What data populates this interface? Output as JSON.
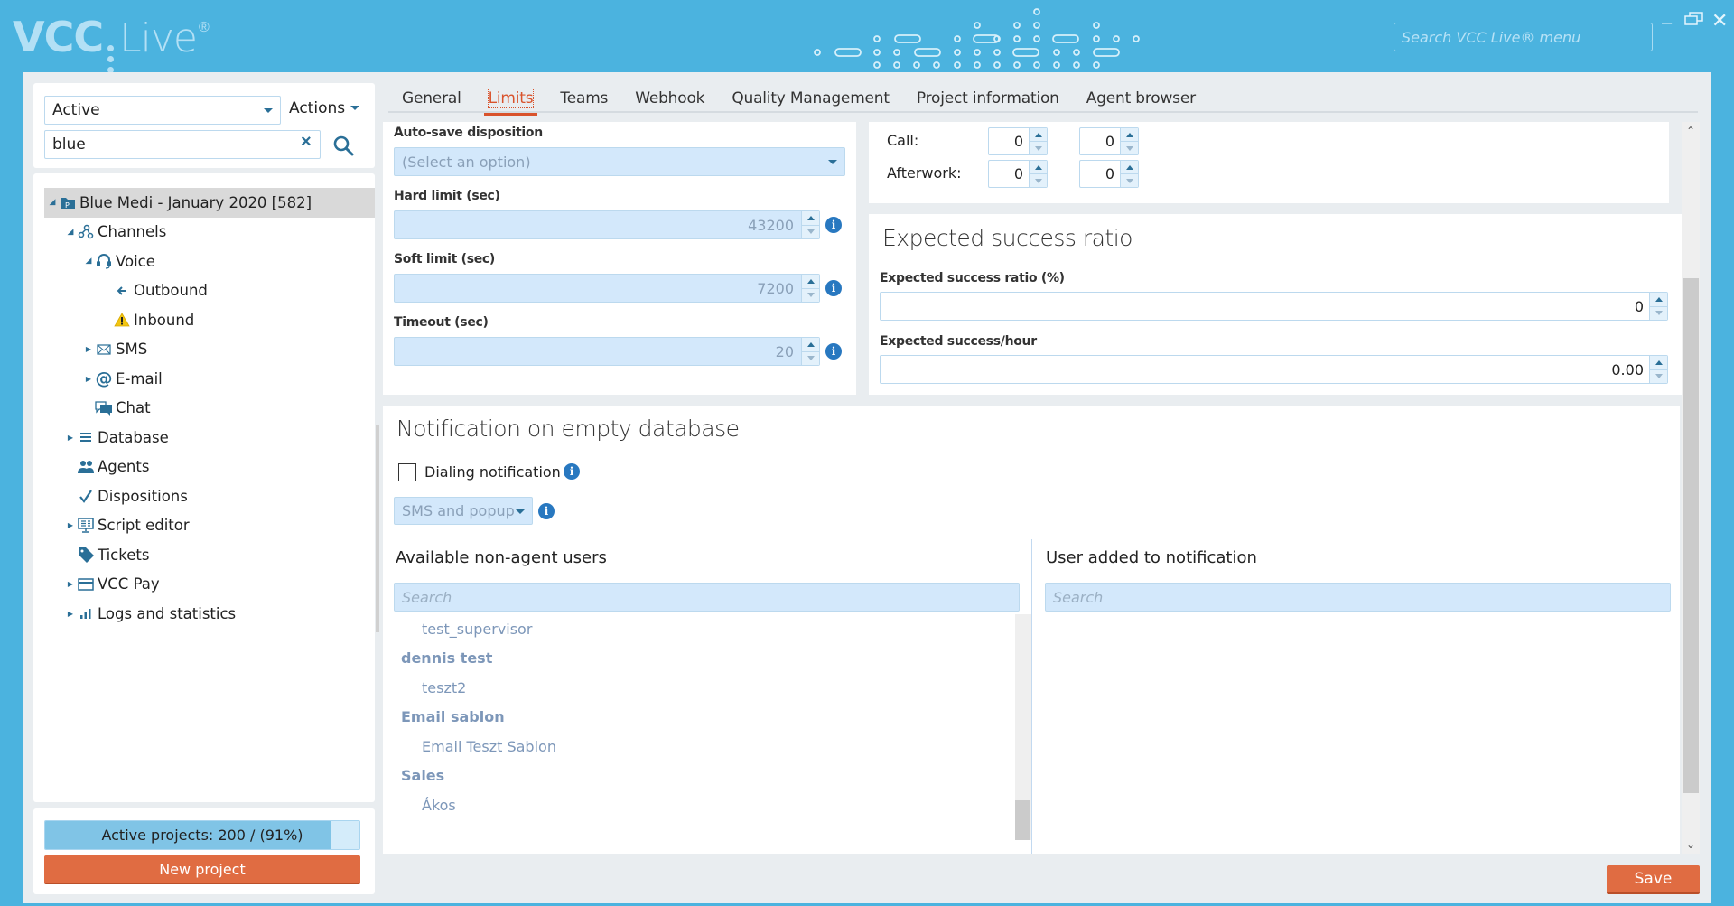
{
  "app": {
    "logo_main": "VCC",
    "logo_sub": "Live",
    "logo_mark": "®",
    "menu_search_placeholder": "Search VCC Live® menu",
    "window_controls": [
      "minimize-icon",
      "restore-icon",
      "close-icon"
    ]
  },
  "sidebar": {
    "status_filter": "Active",
    "actions_label": "Actions",
    "search_value": "blue",
    "tree": [
      {
        "label": "Blue Medi - January 2020 [582]",
        "level": 0,
        "toggle": "expanded",
        "icon": "project-icon",
        "selected": true
      },
      {
        "label": "Channels",
        "level": 1,
        "toggle": "expanded",
        "icon": "channels-icon"
      },
      {
        "label": "Voice",
        "level": 2,
        "toggle": "expanded",
        "icon": "headset-icon"
      },
      {
        "label": "Outbound",
        "level": 3,
        "toggle": "none",
        "icon": "arrow-left-icon"
      },
      {
        "label": "Inbound",
        "level": 3,
        "toggle": "none",
        "icon": "warning-icon"
      },
      {
        "label": "SMS",
        "level": 2,
        "toggle": "collapsed",
        "icon": "envelope-icon"
      },
      {
        "label": "E-mail",
        "level": 2,
        "toggle": "collapsed",
        "icon": "at-icon"
      },
      {
        "label": "Chat",
        "level": 2,
        "toggle": "none",
        "icon": "chat-icon"
      },
      {
        "label": "Database",
        "level": 1,
        "toggle": "collapsed",
        "icon": "list-icon"
      },
      {
        "label": "Agents",
        "level": 1,
        "toggle": "none",
        "icon": "users-icon"
      },
      {
        "label": "Dispositions",
        "level": 1,
        "toggle": "none",
        "icon": "check-icon"
      },
      {
        "label": "Script editor",
        "level": 1,
        "toggle": "collapsed",
        "icon": "monitor-icon"
      },
      {
        "label": "Tickets",
        "level": 1,
        "toggle": "none",
        "icon": "tag-icon"
      },
      {
        "label": "VCC Pay",
        "level": 1,
        "toggle": "collapsed",
        "icon": "card-icon"
      },
      {
        "label": "Logs and statistics",
        "level": 1,
        "toggle": "collapsed",
        "icon": "bar-chart-icon"
      }
    ],
    "active_projects_label": "Active projects: 200 /  (91%)",
    "active_projects_fraction": 0.91,
    "new_project_label": "New project"
  },
  "tabs": [
    {
      "label": "General",
      "active": false
    },
    {
      "label": "Limits",
      "active": true
    },
    {
      "label": "Teams",
      "active": false
    },
    {
      "label": "Webhook",
      "active": false
    },
    {
      "label": "Quality Management",
      "active": false
    },
    {
      "label": "Project information",
      "active": false
    },
    {
      "label": "Agent browser",
      "active": false
    }
  ],
  "limits": {
    "auto_save_label": "Auto-save disposition",
    "auto_save_value": "(Select an option)",
    "hard_limit_label": "Hard limit (sec)",
    "hard_limit_value": "43200",
    "soft_limit_label": "Soft limit (sec)",
    "soft_limit_value": "7200",
    "timeout_label": "Timeout (sec)",
    "timeout_value": "20"
  },
  "times": {
    "call_label": "Call:",
    "call_values": [
      "0",
      "0"
    ],
    "afterwork_label": "Afterwork:",
    "afterwork_values": [
      "0",
      "0"
    ]
  },
  "success": {
    "title": "Expected success ratio",
    "ratio_label": "Expected success ratio (%)",
    "ratio_value": "0",
    "per_hour_label": "Expected success/hour",
    "per_hour_value": "0.00"
  },
  "notification": {
    "title": "Notification on empty database",
    "dialing_label": "Dialing notification",
    "dialing_checked": false,
    "method_value": "SMS and popup",
    "available_title": "Available non-agent users",
    "available_search_placeholder": "Search",
    "added_title": "User added to notification",
    "added_search_placeholder": "Search",
    "available_users": [
      {
        "label": "test_supervisor",
        "type": "user"
      },
      {
        "label": "dennis test",
        "type": "group"
      },
      {
        "label": "teszt2",
        "type": "user"
      },
      {
        "label": "Email sablon",
        "type": "group"
      },
      {
        "label": "Email Teszt Sablon",
        "type": "user"
      },
      {
        "label": "Sales",
        "type": "group"
      },
      {
        "label": "Ákos",
        "type": "user"
      }
    ]
  },
  "footer": {
    "save_label": "Save"
  },
  "colors": {
    "brand": "#4bb3df",
    "accent": "#e06c42",
    "active_tab": "#d9532c",
    "info": "#2878c0"
  }
}
